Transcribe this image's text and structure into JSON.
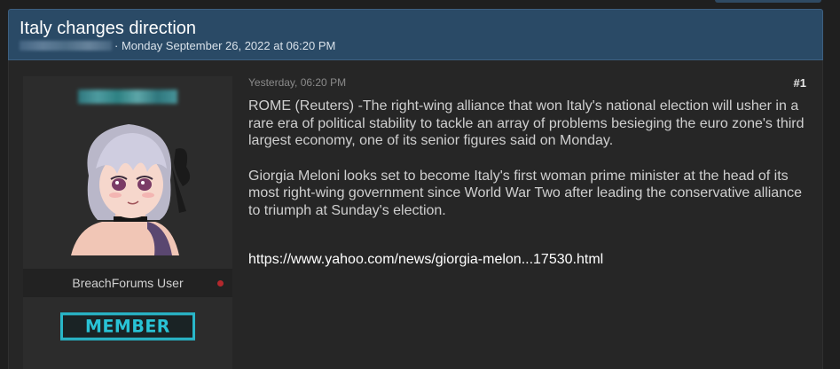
{
  "thread": {
    "title": "Italy changes direction",
    "meta": "· Monday September 26, 2022 at 06:20 PM"
  },
  "post": {
    "date": "Yesterday, 06:20 PM",
    "number": "#1",
    "paragraphs": [
      "ROME (Reuters) -The right-wing alliance that won Italy's national election will usher in a rare era of political stability to tackle an array of problems besieging the euro zone's third largest economy, one of its senior figures said on Monday.",
      "Giorgia Meloni looks set to become Italy's first woman prime minister at the head of its most right-wing government since World War Two after leading the conservative alliance to triumph at Sunday's election."
    ],
    "link": "https://www.yahoo.com/news/giorgia-melon...17530.html"
  },
  "author": {
    "user_title": "BreachForums User",
    "rank": "MEMBER",
    "status_color": "#b3282d",
    "avatar_icon": "anime-avatar"
  },
  "colors": {
    "header_bg": "#2a4a66",
    "rank_accent": "#29b7c9"
  }
}
